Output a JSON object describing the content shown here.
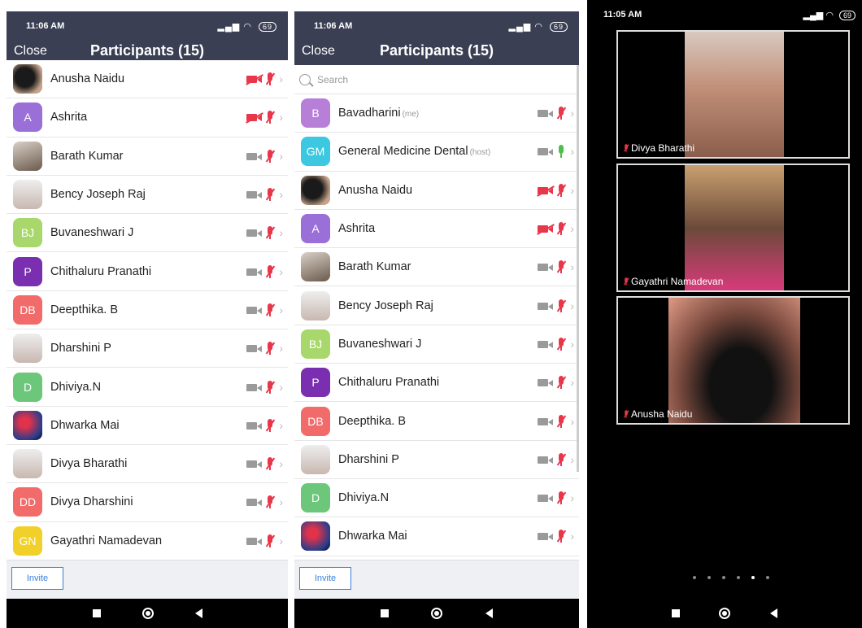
{
  "panel1": {
    "time": "11:06 AM",
    "battery": "69",
    "close": "Close",
    "title": "Participants (15)",
    "invite": "Invite",
    "rows": [
      {
        "name": "Anusha Naidu",
        "avatar": "photo-dark",
        "initials": "",
        "color": "",
        "cam": "off"
      },
      {
        "name": "Ashrita",
        "avatar": "initials",
        "initials": "A",
        "color": "#9b6fd8",
        "cam": "off"
      },
      {
        "name": "Barath Kumar",
        "avatar": "photo",
        "initials": "",
        "color": "",
        "cam": "on"
      },
      {
        "name": "Bency Joseph Raj",
        "avatar": "photo-light",
        "initials": "",
        "color": "",
        "cam": "on"
      },
      {
        "name": "Buvaneshwari J",
        "avatar": "initials",
        "initials": "BJ",
        "color": "#a8d86b",
        "cam": "on"
      },
      {
        "name": "Chithaluru Pranathi",
        "avatar": "initials",
        "initials": "P",
        "color": "#7a2fb0",
        "cam": "on"
      },
      {
        "name": "Deepthika. B",
        "avatar": "initials",
        "initials": "DB",
        "color": "#f26b6b",
        "cam": "on"
      },
      {
        "name": "Dharshini P",
        "avatar": "photo-light",
        "initials": "",
        "color": "",
        "cam": "on"
      },
      {
        "name": "Dhiviya.N",
        "avatar": "initials",
        "initials": "D",
        "color": "#6cc77a",
        "cam": "on"
      },
      {
        "name": "Dhwarka Mai",
        "avatar": "photo-red",
        "initials": "",
        "color": "",
        "cam": "on"
      },
      {
        "name": "Divya Bharathi",
        "avatar": "photo-light",
        "initials": "",
        "color": "",
        "cam": "on"
      },
      {
        "name": "Divya Dharshini",
        "avatar": "initials",
        "initials": "DD",
        "color": "#f26b6b",
        "cam": "on"
      },
      {
        "name": "Gayathri Namadevan",
        "avatar": "initials",
        "initials": "GN",
        "color": "#f2d02a",
        "cam": "on"
      }
    ]
  },
  "panel2": {
    "time": "11:06 AM",
    "battery": "69",
    "close": "Close",
    "title": "Participants (15)",
    "search_placeholder": "Search",
    "invite": "Invite",
    "rows": [
      {
        "name": "Bavadharini",
        "tag": "(me)",
        "avatar": "initials",
        "initials": "B",
        "color": "#b87fd8",
        "cam": "on",
        "mic": "muted"
      },
      {
        "name": "General Medicine Dental",
        "tag": "(host)",
        "avatar": "initials",
        "initials": "GM",
        "color": "#3bc8e0",
        "cam": "on",
        "mic": "on"
      },
      {
        "name": "Anusha Naidu",
        "tag": "",
        "avatar": "photo-dark",
        "initials": "",
        "color": "",
        "cam": "off",
        "mic": "muted"
      },
      {
        "name": "Ashrita",
        "tag": "",
        "avatar": "initials",
        "initials": "A",
        "color": "#9b6fd8",
        "cam": "off",
        "mic": "muted"
      },
      {
        "name": "Barath Kumar",
        "tag": "",
        "avatar": "photo",
        "initials": "",
        "color": "",
        "cam": "on",
        "mic": "muted"
      },
      {
        "name": "Bency Joseph Raj",
        "tag": "",
        "avatar": "photo-light",
        "initials": "",
        "color": "",
        "cam": "on",
        "mic": "muted"
      },
      {
        "name": "Buvaneshwari J",
        "tag": "",
        "avatar": "initials",
        "initials": "BJ",
        "color": "#a8d86b",
        "cam": "on",
        "mic": "muted"
      },
      {
        "name": "Chithaluru Pranathi",
        "tag": "",
        "avatar": "initials",
        "initials": "P",
        "color": "#7a2fb0",
        "cam": "on",
        "mic": "muted"
      },
      {
        "name": "Deepthika. B",
        "tag": "",
        "avatar": "initials",
        "initials": "DB",
        "color": "#f26b6b",
        "cam": "on",
        "mic": "muted"
      },
      {
        "name": "Dharshini P",
        "tag": "",
        "avatar": "photo-light",
        "initials": "",
        "color": "",
        "cam": "on",
        "mic": "muted"
      },
      {
        "name": "Dhiviya.N",
        "tag": "",
        "avatar": "initials",
        "initials": "D",
        "color": "#6cc77a",
        "cam": "on",
        "mic": "muted"
      },
      {
        "name": "Dhwarka Mai",
        "tag": "",
        "avatar": "photo-red",
        "initials": "",
        "color": "",
        "cam": "on",
        "mic": "muted"
      }
    ]
  },
  "panel3": {
    "time": "11:05 AM",
    "battery": "69",
    "tiles": [
      {
        "label": "Divya Bharathi"
      },
      {
        "label": "Gayathri Namadevan"
      },
      {
        "label": "Anusha Naidu"
      }
    ],
    "page_count": 6,
    "active_page": 5
  }
}
